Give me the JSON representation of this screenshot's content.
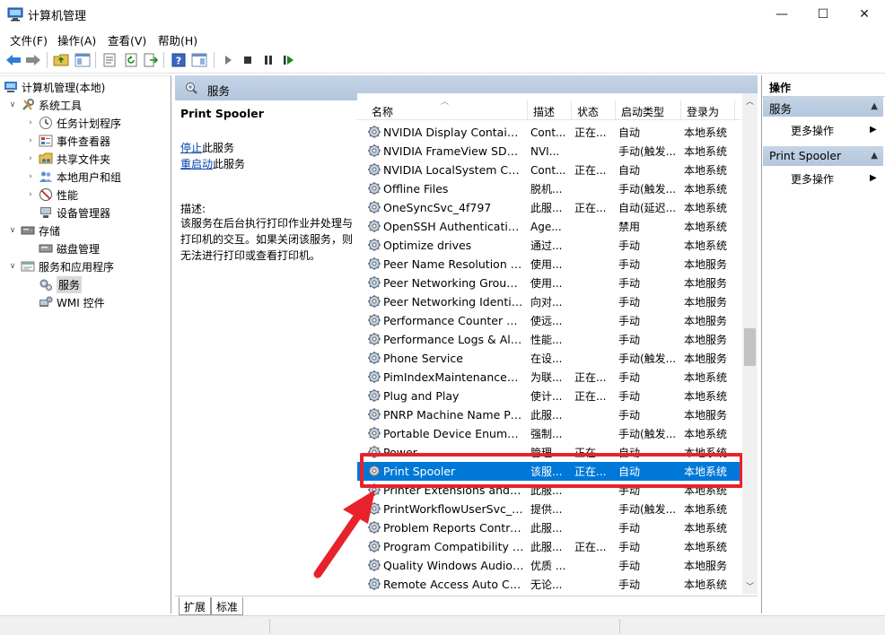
{
  "window": {
    "title": "计算机管理",
    "minimize": "—",
    "maximize": "☐",
    "close": "✕"
  },
  "menu": {
    "items": [
      "文件(F)",
      "操作(A)",
      "查看(V)",
      "帮助(H)"
    ]
  },
  "toolbar": {
    "icons": [
      "back-arrow-icon",
      "forward-arrow-icon",
      "folder-up-icon",
      "console-tree-icon",
      "properties-icon",
      "refresh-icon",
      "export-list-icon",
      "help-icon",
      "show-hide-icon",
      "play-icon",
      "stop-icon",
      "pause-icon",
      "restart-icon"
    ]
  },
  "tree": {
    "root": "计算机管理(本地)",
    "system_tools": "系统工具",
    "task_scheduler": "任务计划程序",
    "event_viewer": "事件查看器",
    "shared_folders": "共享文件夹",
    "local_users": "本地用户和组",
    "performance": "性能",
    "device_manager": "设备管理器",
    "storage": "存储",
    "disk_management": "磁盘管理",
    "services_apps": "服务和应用程序",
    "services": "服务",
    "wmi": "WMI 控件"
  },
  "header": {
    "title": "服务"
  },
  "detail": {
    "service_name": "Print Spooler",
    "stop_link": "停止",
    "stop_suffix": "此服务",
    "restart_link": "重启动",
    "restart_suffix": "此服务",
    "desc_label": "描述:",
    "description": "该服务在后台执行打印作业并处理与打印机的交互。如果关闭该服务，则无法进行打印或查看打印机。"
  },
  "columns": {
    "name": "名称",
    "desc": "描述",
    "status": "状态",
    "startup": "启动类型",
    "logon": "登录为"
  },
  "rows": [
    {
      "name": "NVIDIA Display Containe...",
      "desc": "Cont...",
      "status": "正在...",
      "startup": "自动",
      "logon": "本地系统"
    },
    {
      "name": "NVIDIA FrameView SDK ...",
      "desc": "NVI...",
      "status": "",
      "startup": "手动(触发...",
      "logon": "本地系统"
    },
    {
      "name": "NVIDIA LocalSystem Con...",
      "desc": "Cont...",
      "status": "正在...",
      "startup": "自动",
      "logon": "本地系统"
    },
    {
      "name": "Offline Files",
      "desc": "脱机...",
      "status": "",
      "startup": "手动(触发...",
      "logon": "本地系统"
    },
    {
      "name": "OneSyncSvc_4f797",
      "desc": "此服...",
      "status": "正在...",
      "startup": "自动(延迟...",
      "logon": "本地系统"
    },
    {
      "name": "OpenSSH Authentication ...",
      "desc": "Age...",
      "status": "",
      "startup": "禁用",
      "logon": "本地系统"
    },
    {
      "name": "Optimize drives",
      "desc": "通过...",
      "status": "",
      "startup": "手动",
      "logon": "本地系统"
    },
    {
      "name": "Peer Name Resolution Pr...",
      "desc": "使用...",
      "status": "",
      "startup": "手动",
      "logon": "本地服务"
    },
    {
      "name": "Peer Networking Groupi...",
      "desc": "使用...",
      "status": "",
      "startup": "手动",
      "logon": "本地服务"
    },
    {
      "name": "Peer Networking Identity...",
      "desc": "向对...",
      "status": "",
      "startup": "手动",
      "logon": "本地服务"
    },
    {
      "name": "Performance Counter DL...",
      "desc": "使远...",
      "status": "",
      "startup": "手动",
      "logon": "本地服务"
    },
    {
      "name": "Performance Logs & Aler...",
      "desc": "性能...",
      "status": "",
      "startup": "手动",
      "logon": "本地服务"
    },
    {
      "name": "Phone Service",
      "desc": "在设...",
      "status": "",
      "startup": "手动(触发...",
      "logon": "本地服务"
    },
    {
      "name": "PimIndexMaintenanceSvc...",
      "desc": "为联...",
      "status": "正在...",
      "startup": "手动",
      "logon": "本地系统"
    },
    {
      "name": "Plug and Play",
      "desc": "使计...",
      "status": "正在...",
      "startup": "手动",
      "logon": "本地系统"
    },
    {
      "name": "PNRP Machine Name Pu...",
      "desc": "此服...",
      "status": "",
      "startup": "手动",
      "logon": "本地服务"
    },
    {
      "name": "Portable Device Enumera...",
      "desc": "强制...",
      "status": "",
      "startup": "手动(触发...",
      "logon": "本地系统"
    },
    {
      "name": "Power",
      "desc": "管理...",
      "status": "正在...",
      "startup": "自动",
      "logon": "本地系统"
    },
    {
      "name": "Print Spooler",
      "desc": "该服...",
      "status": "正在...",
      "startup": "自动",
      "logon": "本地系统",
      "selected": true
    },
    {
      "name": "Printer Extensions and N...",
      "desc": "此服...",
      "status": "",
      "startup": "手动",
      "logon": "本地系统"
    },
    {
      "name": "PrintWorkflowUserSvc_4f...",
      "desc": "提供...",
      "status": "",
      "startup": "手动(触发...",
      "logon": "本地系统"
    },
    {
      "name": "Problem Reports Control...",
      "desc": "此服...",
      "status": "",
      "startup": "手动",
      "logon": "本地系统"
    },
    {
      "name": "Program Compatibility A...",
      "desc": "此服...",
      "status": "正在...",
      "startup": "手动",
      "logon": "本地系统"
    },
    {
      "name": "Quality Windows Audio V...",
      "desc": "优质 ...",
      "status": "",
      "startup": "手动",
      "logon": "本地服务"
    },
    {
      "name": "Remote Access Auto Con...",
      "desc": "无论...",
      "status": "",
      "startup": "手动",
      "logon": "本地系统"
    }
  ],
  "tabs": [
    "扩展",
    "标准"
  ],
  "actions": {
    "header": "操作",
    "section1": "服务",
    "section1_item": "更多操作",
    "section2": "Print Spooler",
    "section2_item": "更多操作"
  },
  "colors": {
    "selection": "#0078d7",
    "header_band": "#b9cade",
    "annotation_red": "#e8222a",
    "link": "#0645ad"
  }
}
